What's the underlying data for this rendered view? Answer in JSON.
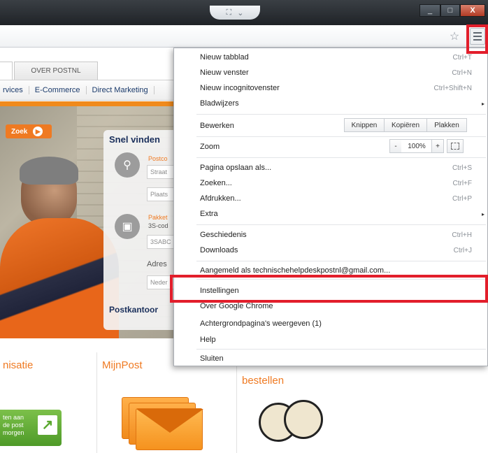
{
  "window": {
    "tab_notch_icons": [
      "fullscreen-icon",
      "chevron-down-icon"
    ],
    "buttons": {
      "minimize": "_",
      "maximize": "□",
      "close": "X"
    }
  },
  "toolbar": {
    "star_glyph": "☆"
  },
  "site": {
    "tabs": [
      "",
      "OVER POSTNL"
    ],
    "nav": [
      "rvices",
      "E-Commerce",
      "Direct Marketing"
    ],
    "zoek_button": "Zoek",
    "snel_vinden": {
      "title": "Snel vinden",
      "postcode_label": "Postco",
      "straat_placeholder": "Straat",
      "plaats_placeholder": "Plaats",
      "pakket_label_1": "Pakket",
      "pakket_label_2": "3S-cod",
      "code_placeholder": "3SABC",
      "adres_label": "Adres",
      "land_placeholder": "Neder",
      "postkantoor": "Postkantoor"
    },
    "sections": [
      "nisatie",
      "MijnPost",
      "bestellen"
    ],
    "green_box_text": [
      "ten aan",
      "de post",
      "morgen"
    ]
  },
  "menu": {
    "items": [
      {
        "label": "Nieuw tabblad",
        "shortcut": "Ctrl+T"
      },
      {
        "label": "Nieuw venster",
        "shortcut": "Ctrl+N"
      },
      {
        "label": "Nieuw incognitovenster",
        "shortcut": "Ctrl+Shift+N"
      },
      {
        "label": "Bladwijzers",
        "submenu": "▸"
      },
      {
        "label": "Bewerken"
      },
      {
        "label": "Zoom"
      },
      {
        "label": "Pagina opslaan als...",
        "shortcut": "Ctrl+S"
      },
      {
        "label": "Zoeken...",
        "shortcut": "Ctrl+F"
      },
      {
        "label": "Afdrukken...",
        "shortcut": "Ctrl+P"
      },
      {
        "label": "Extra",
        "submenu": "▸"
      },
      {
        "label": "Geschiedenis",
        "shortcut": "Ctrl+H"
      },
      {
        "label": "Downloads",
        "shortcut": "Ctrl+J"
      },
      {
        "label": "Aangemeld als technischehelpdeskpostnl@gmail.com..."
      },
      {
        "label": "Instellingen"
      },
      {
        "label": "Over Google Chrome"
      },
      {
        "label": "Achtergrondpagina's weergeven (1)"
      },
      {
        "label": "Help"
      },
      {
        "label": "Sluiten"
      }
    ],
    "edit_buttons": {
      "cut": "Knippen",
      "copy": "Kopiëren",
      "paste": "Plakken"
    },
    "zoom": {
      "minus": "-",
      "value": "100%",
      "plus": "+"
    }
  },
  "highlight_color": "#e21e2b"
}
